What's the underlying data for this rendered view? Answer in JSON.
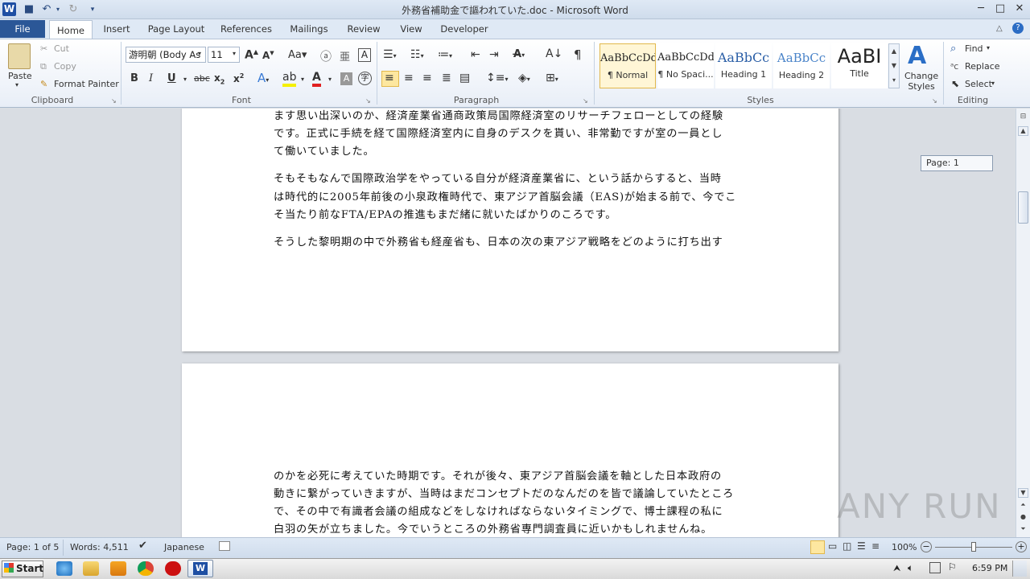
{
  "window": {
    "title": "外務省補助金で謳われていた.doc - Microsoft Word",
    "minimize": "─",
    "maximize": "□",
    "close": "✕"
  },
  "tabs": [
    "File",
    "Home",
    "Insert",
    "Page Layout",
    "References",
    "Mailings",
    "Review",
    "View",
    "Developer"
  ],
  "clipboard": {
    "paste": "Paste",
    "cut": "Cut",
    "copy": "Copy",
    "format_painter": "Format Painter",
    "label": "Clipboard"
  },
  "font": {
    "name": "游明朝 (Body As",
    "size": "11",
    "label": "Font"
  },
  "paragraph": {
    "label": "Paragraph"
  },
  "styles": {
    "label": "Styles",
    "items": [
      {
        "sample": "AaBbCcDdI",
        "name": "¶ Normal"
      },
      {
        "sample": "AaBbCcDdI",
        "name": "¶ No Spaci..."
      },
      {
        "sample": "AaBbCc",
        "name": "Heading 1"
      },
      {
        "sample": "AaBbCc",
        "name": "Heading 2"
      },
      {
        "sample": "AaBI",
        "name": "Title"
      }
    ],
    "change_styles": "Change Styles"
  },
  "editing": {
    "find": "Find",
    "replace": "Replace",
    "select": "Select",
    "label": "Editing"
  },
  "page_tooltip": "Page: 1",
  "document": {
    "page1_lines": [
      "ます思い出深いのか、経済産業省通商政策局国際経済室のリサーチフェローとしての経験",
      "です。正式に手続を経て国際経済室内に自身のデスクを貰い、非常勤ですが室の一員とし",
      "て働いていました。",
      "そもそもなんで国際政治学をやっている自分が経済産業省に、という話からすると、当時",
      "は時代的に2005年前後の小泉政権時代で、東アジア首脳会議（EAS)が始まる前で、今でこ",
      "そ当たり前なFTA/EPAの推進もまだ緒に就いたばかりのころです。",
      "そうした黎明期の中で外務省も経産省も、日本の次の東アジア戦略をどのように打ち出す"
    ],
    "page2_lines": [
      "のかを必死に考えていた時期です。それが後々、東アジア首脳会議を軸とした日本政府の",
      "動きに繋がっていきますが、当時はまだコンセプトだのなんだのを皆で議論していたところ",
      "で、その中で有識者会議の組成などをしなければならないタイミングで、博士課程の私に",
      "白羽の矢が立ちました。今でいうところの外務省専門調査員に近いかもしれませんね。"
    ]
  },
  "status": {
    "page": "Page: 1 of 5",
    "words": "Words: 4,511",
    "language": "Japanese",
    "zoom": "100%"
  },
  "taskbar": {
    "start": "Start",
    "time": "6:59 PM"
  },
  "watermark": "ANY RUN"
}
